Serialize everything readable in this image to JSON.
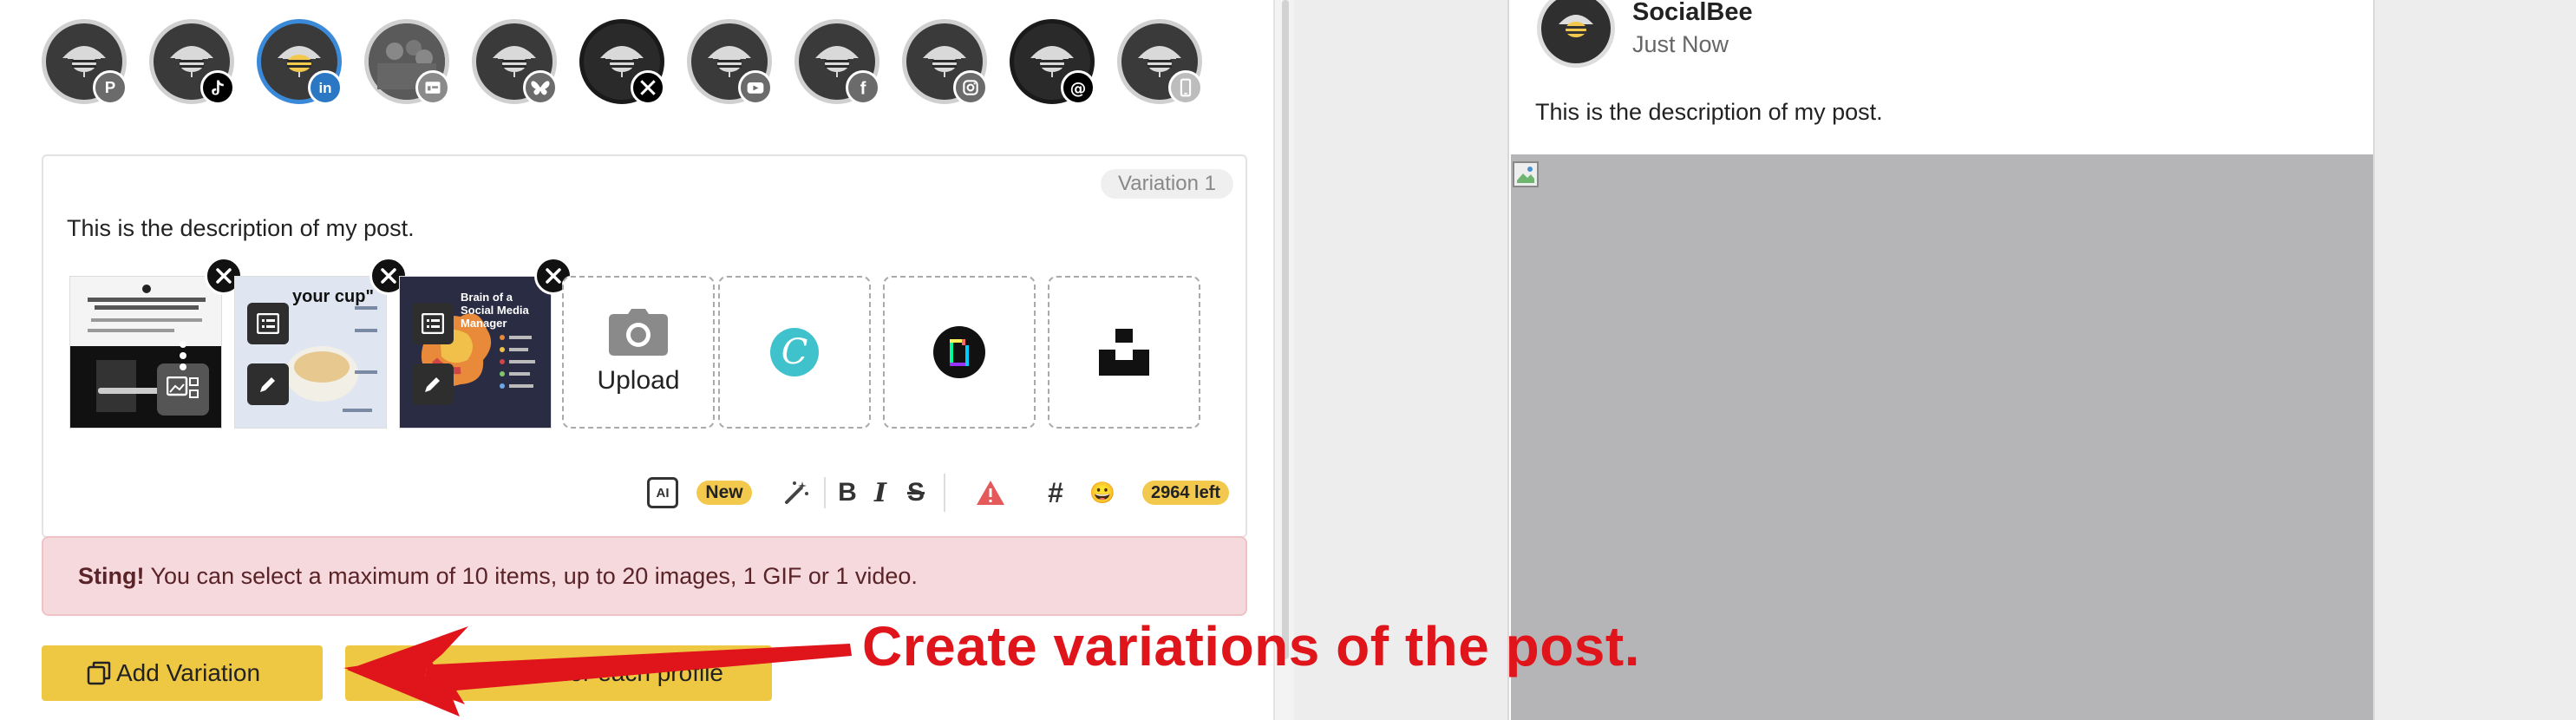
{
  "profiles": [
    {
      "network": "pinterest",
      "icon": "pinterest-icon",
      "badge_color": "#6b6b6b",
      "selected": false
    },
    {
      "network": "tiktok",
      "icon": "tiktok-icon",
      "badge_color": "#000000",
      "selected": false
    },
    {
      "network": "linkedin",
      "icon": "linkedin-icon",
      "badge_color": "#2a78c4",
      "selected": true
    },
    {
      "network": "google-business",
      "icon": "google-business-icon",
      "badge_color": "#8a8a8a",
      "selected": false
    },
    {
      "network": "bluesky",
      "icon": "bluesky-icon",
      "badge_color": "#6b6b6b",
      "selected": false
    },
    {
      "network": "x",
      "icon": "x-icon",
      "badge_color": "#000000",
      "selected": false
    },
    {
      "network": "youtube",
      "icon": "youtube-icon",
      "badge_color": "#6b6b6b",
      "selected": false
    },
    {
      "network": "facebook",
      "icon": "facebook-icon",
      "badge_color": "#6b6b6b",
      "selected": false
    },
    {
      "network": "instagram",
      "icon": "instagram-icon",
      "badge_color": "#6b6b6b",
      "selected": false
    },
    {
      "network": "threads",
      "icon": "threads-icon",
      "badge_color": "#000000",
      "selected": false
    },
    {
      "network": "mobile",
      "icon": "mobile-icon",
      "badge_color": "#bdbdbd",
      "selected": false
    }
  ],
  "editor": {
    "variation_label": "Variation 1",
    "description": "This is the description of my post.",
    "media": [
      {
        "name": "video-thumbnail",
        "kind": "video"
      },
      {
        "name": "your-cup-image",
        "kind": "image",
        "caption": "your cup\""
      },
      {
        "name": "brain-social-manager-image",
        "kind": "image",
        "caption": "Brain of a Social Media Manager"
      }
    ],
    "upload_label": "Upload",
    "canva_letter": "C",
    "toolbar": {
      "ai_label": "AI",
      "new_badge": "New",
      "bold": "B",
      "italic": "I",
      "strike": "S",
      "hashtag": "#",
      "emoji": "😀",
      "chars_left": "2964 left"
    }
  },
  "alert": {
    "strong": "Sting!",
    "text": " You can select a maximum of 10 items, up to 20 images, 1 GIF or 1 video."
  },
  "buttons": {
    "add_variation": "Add Variation",
    "customize": "Customize for each profile",
    "customize_visible": "stomize for each profile"
  },
  "annotation": {
    "text": "Create variations of the post."
  },
  "preview": {
    "account_name": "SocialBee",
    "timestamp": "Just Now",
    "description": "This is the description of my post."
  },
  "colors": {
    "accent_yellow": "#eec843",
    "alert_bg": "#f5d9dc",
    "annotation_red": "#e0141b",
    "selected_ring": "#3a8ad9"
  }
}
